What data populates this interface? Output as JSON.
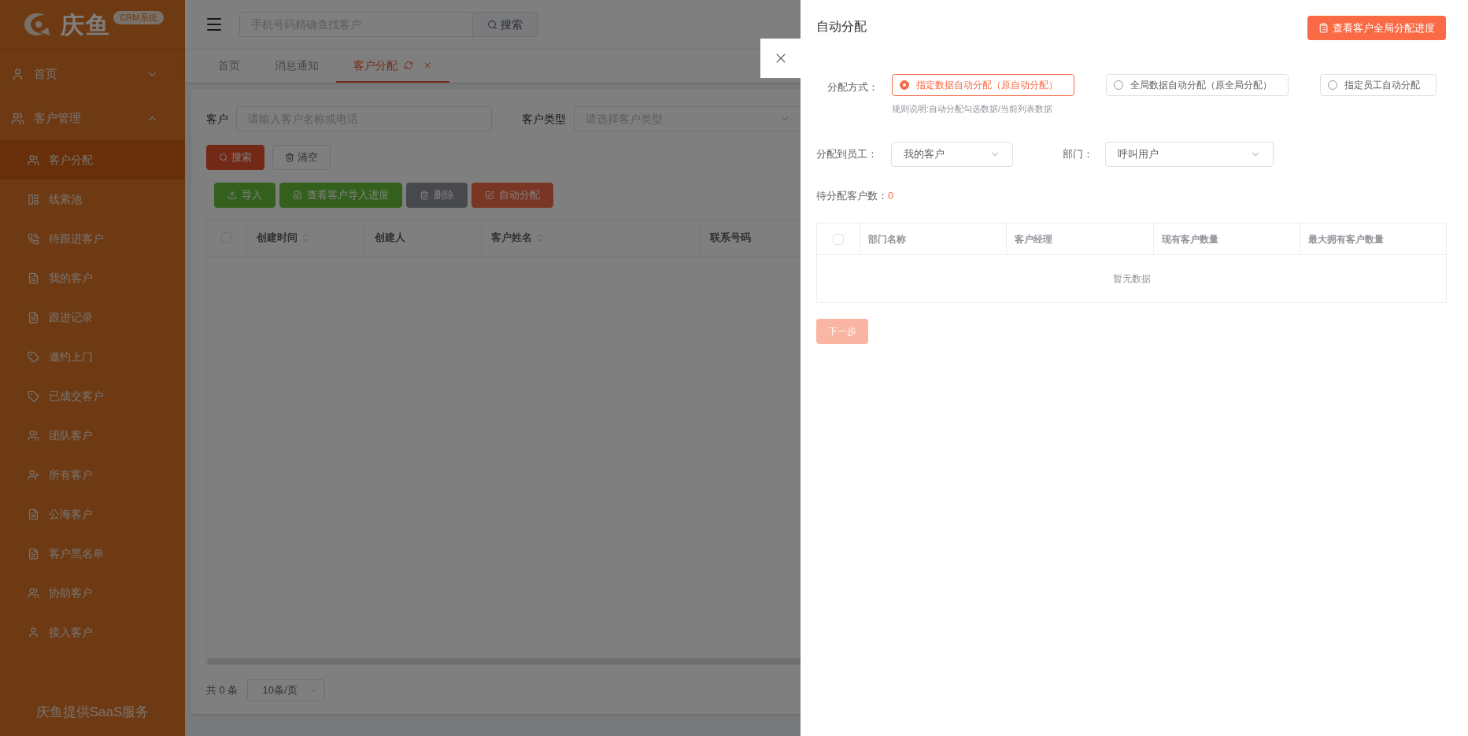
{
  "logo": {
    "text": "庆鱼",
    "badge": "CRM系统"
  },
  "sidebar": {
    "items": [
      {
        "label": "首页",
        "expanded": false
      },
      {
        "label": "客户管理",
        "expanded": true,
        "children": [
          {
            "label": "客户分配",
            "selected": true
          },
          {
            "label": "线索池",
            "selected": false
          },
          {
            "label": "待跟进客户",
            "selected": false
          },
          {
            "label": "我的客户",
            "selected": false
          },
          {
            "label": "跟进记录",
            "selected": false
          },
          {
            "label": "邀约上门",
            "selected": false
          },
          {
            "label": "已成交客户",
            "selected": false
          },
          {
            "label": "团队客户",
            "selected": false
          },
          {
            "label": "所有客户",
            "selected": false
          },
          {
            "label": "公海客户",
            "selected": false
          },
          {
            "label": "客户黑名单",
            "selected": false
          },
          {
            "label": "协助客户",
            "selected": false
          },
          {
            "label": "接入客户",
            "selected": false
          }
        ]
      }
    ],
    "footer": "庆鱼提供SaaS服务"
  },
  "header": {
    "search": {
      "placeholder": "手机号码精确查找客户",
      "button": "搜索"
    }
  },
  "tabs": [
    {
      "label": "首页",
      "selected": false,
      "closable": false
    },
    {
      "label": "消息通知",
      "selected": false,
      "closable": false
    },
    {
      "label": "客户分配",
      "selected": true,
      "closable": true
    }
  ],
  "filters": [
    {
      "kind": "input",
      "label": "客户",
      "placeholder": "请输入客户名称或电话"
    },
    {
      "kind": "select",
      "label": "客户类型",
      "placeholder": "请选择客户类型"
    }
  ],
  "filter_buttons": [
    {
      "kind": "primary",
      "label": "搜索"
    },
    {
      "kind": "plain",
      "label": "清空"
    }
  ],
  "toolbar": [
    {
      "kind": "success",
      "label": "导入"
    },
    {
      "kind": "success",
      "label": "查看客户导入进度"
    },
    {
      "kind": "info",
      "label": "删除"
    },
    {
      "kind": "danger",
      "label": "自动分配"
    }
  ],
  "table": {
    "select_all_checked": false,
    "columns": [
      {
        "label": "创建时间",
        "sortable": true
      },
      {
        "label": "创建人",
        "sortable": false
      },
      {
        "label": "客户姓名",
        "sortable": true
      },
      {
        "label": "联系号码",
        "sortable": false
      }
    ]
  },
  "pagination": {
    "total": "共 0 条",
    "page_size": "10条/页"
  },
  "drawer": {
    "title": "自动分配",
    "top_button": "查看客户全局分配进度",
    "mode": {
      "label": "分配方式：",
      "options": [
        {
          "label": "指定数据自动分配（原自动分配）",
          "selected": true
        },
        {
          "label": "全局数据自动分配（原全局分配）",
          "selected": false
        },
        {
          "label": "指定员工自动分配",
          "selected": false
        }
      ],
      "note": "规则说明:自动分配勾选数据/当前列表数据"
    },
    "employee": {
      "label": "分配到员工：",
      "value": "我的客户"
    },
    "department": {
      "label": "部门：",
      "value": "呼叫用户"
    },
    "pending": {
      "label": "待分配客户数：",
      "value": "0"
    },
    "table": {
      "select_all_checked": false,
      "columns": [
        "部门名称",
        "客户经理",
        "现有客户数量",
        "最大拥有客户数量"
      ],
      "empty_text": "暂无数据"
    },
    "next_button": {
      "label": "下一步",
      "disabled": true
    }
  }
}
